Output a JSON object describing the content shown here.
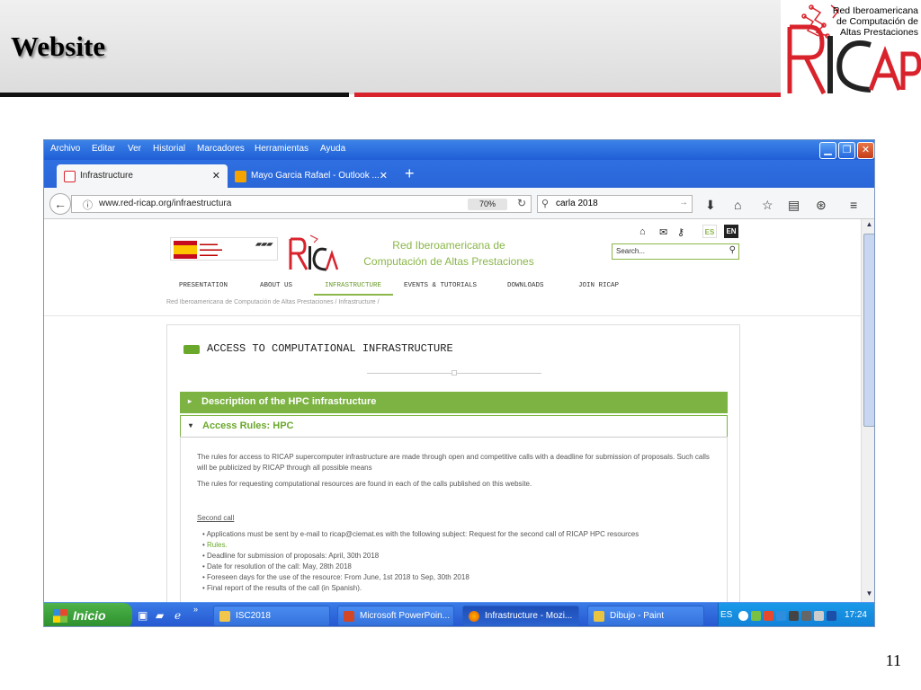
{
  "slide": {
    "title": "Website",
    "page_number": "11",
    "logo_text": [
      "Red Iberoamericana",
      "de Computación de",
      "Altas Prestaciones"
    ]
  },
  "browser": {
    "menu": [
      "Archivo",
      "Editar",
      "Ver",
      "Historial",
      "Marcadores",
      "Herramientas",
      "Ayuda"
    ],
    "tabs": [
      {
        "label": "Infrastructure",
        "active": true
      },
      {
        "label": "Mayo Garcia Rafael - Outlook ...",
        "active": false
      }
    ],
    "url": "www.red-ricap.org/infraestructura",
    "zoom": "70%",
    "search_value": "carla 2018"
  },
  "website": {
    "header_title": [
      "Red Iberoamericana de",
      "Computación de Altas Prestaciones"
    ],
    "lang": [
      "ES",
      "EN"
    ],
    "search_placeholder": "Search...",
    "nav": [
      "PRESENTATION",
      "ABOUT US",
      "INFRASTRUCTURE",
      "EVENTS & TUTORIALS",
      "DOWNLOADS",
      "JOIN RICAP"
    ],
    "breadcrumb": "Red Iberoamericana de Computación de Altas Prestaciones  /  Infrastructure  /",
    "section_title": "ACCESS TO COMPUTATIONAL INFRASTRUCTURE",
    "accordion": [
      {
        "label": "Description of the HPC infrastructure",
        "open": false
      },
      {
        "label": "Access Rules: HPC",
        "open": true
      }
    ],
    "paragraphs": [
      "The rules for access to RICAP supercomputer infrastructure are made through open and competitive calls with a deadline for submission of proposals. Such calls will be publicized by RICAP through all possible means",
      "The rules for requesting computational resources are found in each of the calls published on this website."
    ],
    "call_heading": "Second call",
    "call_items": [
      "Applications must be sent by e-mail to ricap@ciemat.es with the following subject: Request for the second call of RICAP HPC resources",
      "Rules.",
      "Deadline for submission of proposals: April, 30th 2018",
      "Date for resolution of the call: May, 28th 2018",
      "Foreseen days for the use of the resource: From June, 1st 2018 to Sep, 30th 2018",
      "Final report of the results of the call (in Spanish)."
    ]
  },
  "taskbar": {
    "start": "Inicio",
    "tasks": [
      "ISC2018",
      "Microsoft PowerPoin...",
      "Infrastructure - Mozi...",
      "Dibujo - Paint"
    ],
    "lang": "ES",
    "clock": "17:24"
  }
}
